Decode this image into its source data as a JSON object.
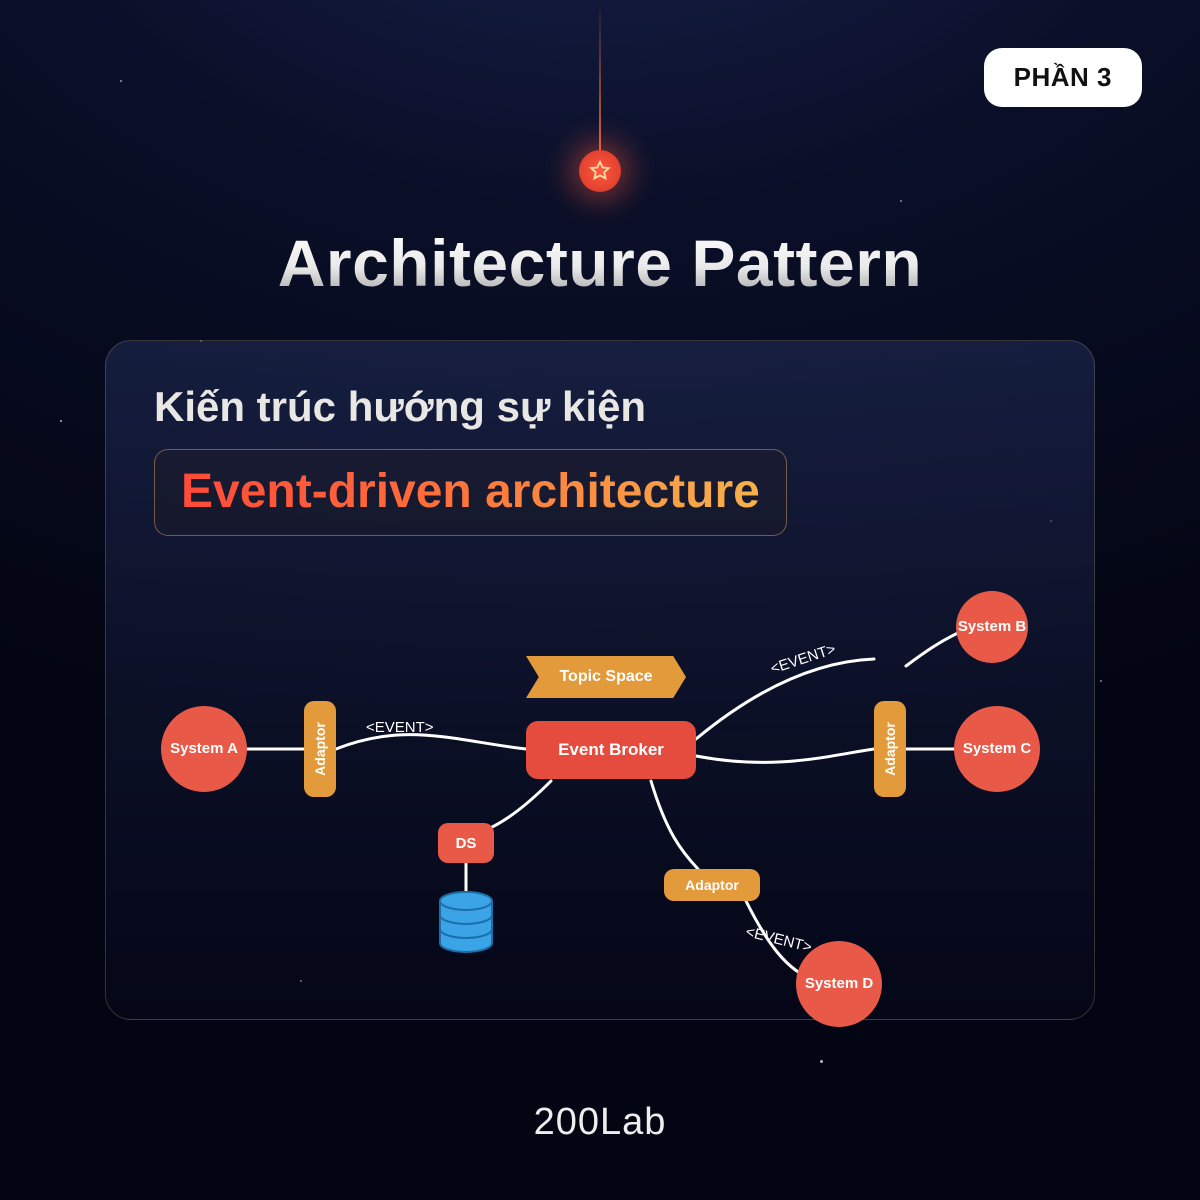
{
  "badge": "PHẦN 3",
  "title": "Architecture Pattern",
  "subtitle": "Kiến trúc hướng sự kiện",
  "highlight": "Event-driven architecture",
  "footer": "200Lab",
  "diagram": {
    "topic_space": "Topic Space",
    "event_broker": "Event Broker",
    "ds": "DS",
    "adaptor": "Adaptor",
    "event_label": "<EVENT>",
    "systems": {
      "a": "System A",
      "b": "System B",
      "c": "System C",
      "d": "System D"
    }
  },
  "colors": {
    "accent_red": "#e85a47",
    "accent_orange": "#e39a3a",
    "broker_red": "#e64c3e"
  }
}
